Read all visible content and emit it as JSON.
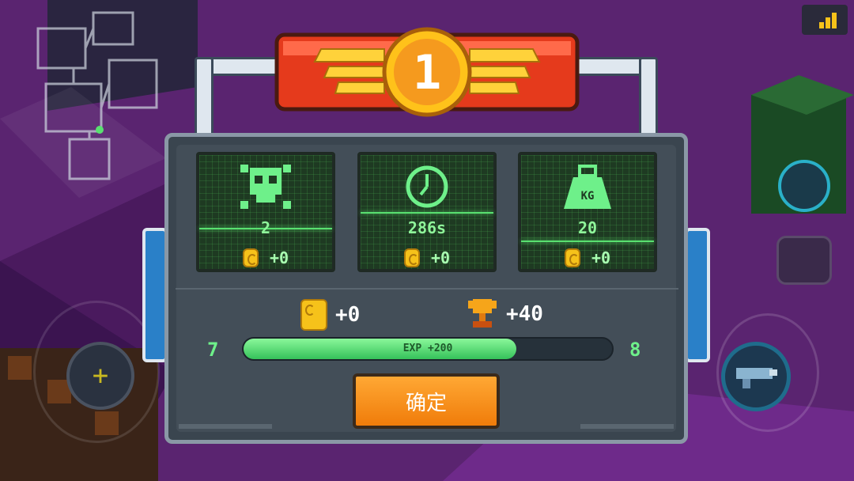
{
  "banner": {
    "rank": "1"
  },
  "cards": [
    {
      "icon": "skull-icon",
      "stat": "2",
      "coin_reward": "+0"
    },
    {
      "icon": "clock-icon",
      "stat": "286s",
      "coin_reward": "+0"
    },
    {
      "icon": "weight-icon",
      "weight_label": "KG",
      "stat": "20",
      "coin_reward": "+0"
    }
  ],
  "totals": {
    "coins": "+0",
    "trophy": "+40"
  },
  "exp": {
    "level_current": "7",
    "level_next": "8",
    "label": "EXP +200",
    "fill_fraction": 0.74
  },
  "confirm_label": "确定",
  "colors": {
    "accent_green": "#6ef08a",
    "button_orange": "#f59a1e",
    "banner_red": "#e53a1c",
    "panel": "#3a454f"
  }
}
